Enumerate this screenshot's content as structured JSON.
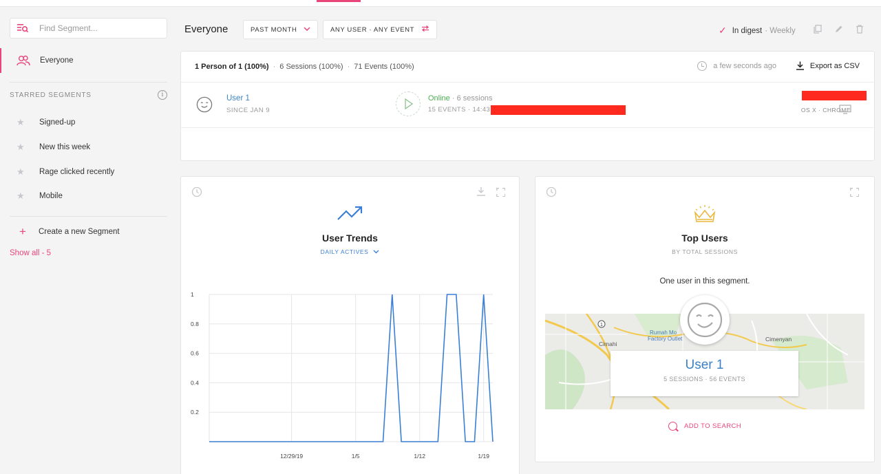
{
  "colors": {
    "accent": "#e8457a",
    "link_blue": "#3b82c4",
    "online_green": "#4caf50",
    "chart_line": "#3a7fd5",
    "redaction": "#ff2a1f"
  },
  "sidebar": {
    "search_placeholder": "Find Segment...",
    "active_segment": "Everyone",
    "starred_header": "STARRED SEGMENTS",
    "starred": [
      "Signed-up",
      "New this week",
      "Rage clicked recently",
      "Mobile"
    ],
    "create_label": "Create a new Segment",
    "show_all": "Show all - 5"
  },
  "header": {
    "title": "Everyone",
    "date_filter": "PAST MONTH",
    "user_filter": "ANY USER · ANY EVENT",
    "digest_label": "In digest",
    "digest_freq": "· Weekly"
  },
  "people": {
    "summary_persons": "1 Person of 1 (100%)",
    "summary_sessions": "6 Sessions (100%)",
    "summary_events": "71 Events (100%)",
    "updated": "a few seconds ago",
    "export_label": "Export as CSV",
    "user": {
      "name": "User 1",
      "since": "SINCE JAN 9",
      "status": "Online",
      "sessions": "· 6 sessions",
      "events": "15 EVENTS · 14:43 ·",
      "platform": "OS X · CHROME"
    }
  },
  "trends": {
    "title": "User Trends",
    "metric": "DAILY ACTIVES"
  },
  "top_users": {
    "title": "Top Users",
    "subtitle": "BY TOTAL SESSIONS",
    "note": "One user in this segment.",
    "user_name": "User 1",
    "user_stats": "5 SESSIONS · 56 EVENTS",
    "add_to_search": "ADD TO SEARCH",
    "map_labels": [
      "Cimahi",
      "Rumah Mo",
      "Factory Outlet",
      "Cimenyan"
    ]
  },
  "chart_data": {
    "type": "line",
    "title": "User Trends",
    "ylim": [
      0,
      1
    ],
    "yticks": [
      "0.2",
      "0.4",
      "0.6",
      "0.8",
      "1"
    ],
    "xticks": [
      "12/29/19",
      "1/5",
      "1/12",
      "1/19"
    ],
    "x": [
      "12/20",
      "12/21",
      "12/22",
      "12/23",
      "12/24",
      "12/25",
      "12/26",
      "12/27",
      "12/28",
      "12/29",
      "12/30",
      "12/31",
      "1/1",
      "1/2",
      "1/3",
      "1/4",
      "1/5",
      "1/6",
      "1/7",
      "1/8",
      "1/9",
      "1/10",
      "1/11",
      "1/12",
      "1/13",
      "1/14",
      "1/15",
      "1/16",
      "1/17",
      "1/18",
      "1/19",
      "1/20"
    ],
    "series": [
      {
        "values": [
          0,
          0,
          0,
          0,
          0,
          0,
          0,
          0,
          0,
          0,
          0,
          0,
          0,
          0,
          0,
          0,
          0,
          0,
          0,
          0,
          1,
          0,
          0,
          0,
          0,
          0,
          1,
          1,
          0,
          0,
          1,
          0
        ]
      }
    ],
    "grid": true
  }
}
